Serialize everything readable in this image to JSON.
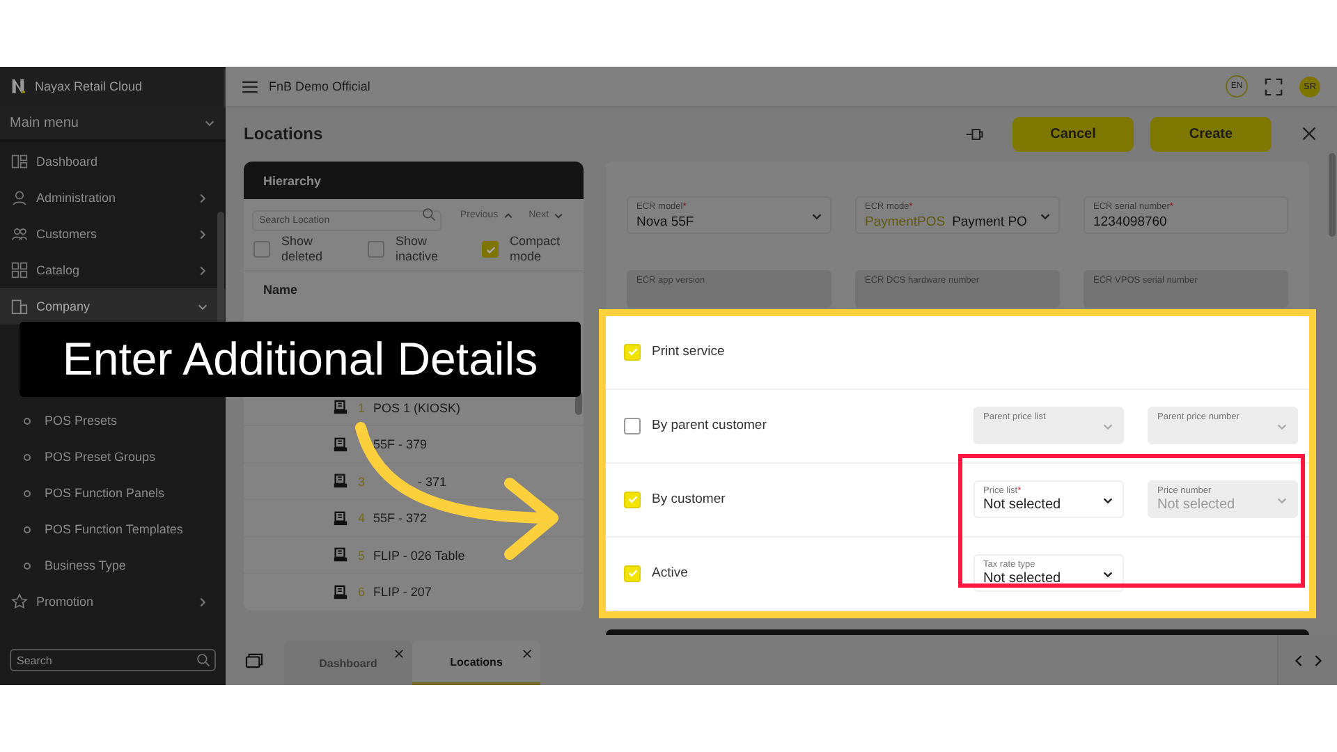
{
  "app": {
    "name": "Nayax Retail Cloud"
  },
  "sidebar": {
    "header": "Main menu",
    "search_placeholder": "Search",
    "items": [
      {
        "label": "Dashboard",
        "kind": "link",
        "selected": false
      },
      {
        "label": "Administration",
        "kind": "group",
        "expanded": false,
        "selected": false
      },
      {
        "label": "Customers",
        "kind": "group",
        "expanded": false,
        "selected": false
      },
      {
        "label": "Catalog",
        "kind": "group",
        "expanded": false,
        "selected": false
      },
      {
        "label": "Company",
        "kind": "group",
        "expanded": true,
        "selected": true
      },
      {
        "label": "POS Presets",
        "kind": "submenu",
        "selected": false
      },
      {
        "label": "POS Preset Groups",
        "kind": "submenu",
        "selected": false
      },
      {
        "label": "POS Function Panels",
        "kind": "submenu",
        "selected": false
      },
      {
        "label": "POS Function Templates",
        "kind": "submenu",
        "selected": false
      },
      {
        "label": "Business Type",
        "kind": "submenu",
        "selected": false
      },
      {
        "label": "Promotion",
        "kind": "group",
        "expanded": false,
        "selected": false
      }
    ]
  },
  "topbar": {
    "title": "FnB Demo Official",
    "language": "EN",
    "user_initials": "SR"
  },
  "page": {
    "title": "Locations",
    "buttons": [
      {
        "label": "Cancel"
      },
      {
        "label": "Create"
      }
    ]
  },
  "hierarchy": {
    "title": "Hierarchy",
    "search_placeholder": "Search Location",
    "previous": "Previous",
    "next": "Next",
    "options": [
      {
        "label": "Show deleted",
        "checked": false
      },
      {
        "label": "Show inactive",
        "checked": false
      },
      {
        "label": "Compact mode",
        "checked": true
      }
    ],
    "column": "Name",
    "rows": [
      {
        "number": "1",
        "name": "POS 1 (KIOSK)"
      },
      {
        "name": "55F - 379"
      },
      {
        "number": "3",
        "name": "- 371"
      },
      {
        "number": "4",
        "name": "55F - 372"
      },
      {
        "number": "5",
        "name": "FLIP - 026 Table"
      },
      {
        "number": "6",
        "name": "FLIP - 207"
      }
    ]
  },
  "form": {
    "rows": [
      [
        {
          "label": "ECR model",
          "mark": "*",
          "value": "Nova 55F",
          "kind": "dropdown",
          "disabled": false
        },
        {
          "label": "ECR mode",
          "mark": "*",
          "prefix": "PaymentPOS",
          "value": "Payment PO",
          "kind": "dropdown",
          "disabled": false
        },
        {
          "label": "ECR serial number",
          "mark": "*",
          "value": "1234098760",
          "kind": "text",
          "disabled": false
        }
      ],
      [
        {
          "label": "ECR app version",
          "kind": "text",
          "disabled": true
        },
        {
          "label": "ECR DCS hardware number",
          "kind": "text",
          "disabled": true
        },
        {
          "label": "ECR VPOS serial number",
          "kind": "text",
          "disabled": true
        }
      ]
    ]
  },
  "details": {
    "rows": [
      {
        "label": "Print service",
        "checked": true
      },
      {
        "label": "By parent customer",
        "checked": false,
        "fields": [
          {
            "label": "Parent price list",
            "disabled": true
          },
          {
            "label": "Parent price number",
            "disabled": true
          }
        ]
      },
      {
        "label": "By customer",
        "checked": true,
        "fields": [
          {
            "label": "Price list",
            "mark": "*",
            "value": "Not selected",
            "disabled": false
          },
          {
            "label": "Price number",
            "value": "Not selected",
            "disabled": true
          }
        ]
      },
      {
        "label": "Active",
        "checked": true,
        "fields": [
          {
            "label": "Tax rate type",
            "value": "Not selected",
            "disabled": false
          }
        ]
      }
    ]
  },
  "callout": {
    "text": "Enter Additional Details"
  },
  "tabs": [
    {
      "label": "Dashboard",
      "selected": false
    },
    {
      "label": "Locations",
      "selected": true
    }
  ]
}
